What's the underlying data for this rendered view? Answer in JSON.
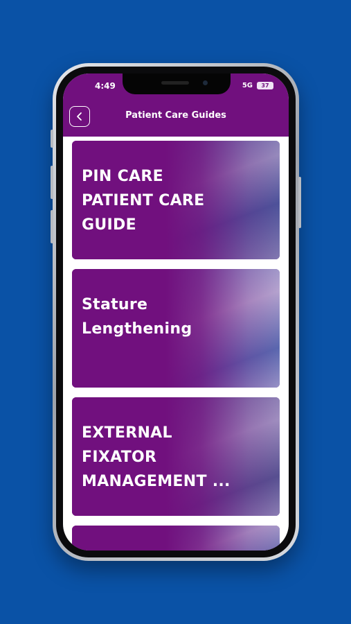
{
  "status_bar": {
    "time": "4:49",
    "network": "5G",
    "battery": "37"
  },
  "app_bar": {
    "title": "Patient Care Guides",
    "back_icon": "chevron-left-icon"
  },
  "colors": {
    "background": "#0a52a6",
    "brand_purple": "#71107e",
    "text": "#ffffff"
  },
  "guides": [
    {
      "title": "PIN CARE PATIENT CARE GUIDE",
      "photo_colors": [
        "#5a86b8",
        "#a7c0d8",
        "#3d6fa6"
      ]
    },
    {
      "title": "Stature Lengthening",
      "photo_colors": [
        "#7fb5dc",
        "#d3e4f2",
        "#4f8dc4"
      ]
    },
    {
      "title": "EXTERNAL FIXATOR MANAGEMENT ...",
      "photo_colors": [
        "#6a88b0",
        "#b4c6dc",
        "#4b6c99"
      ]
    },
    {
      "title": "",
      "photo_colors": [
        "#6f9cc9",
        "#c9dced",
        "#3f78b5"
      ]
    }
  ]
}
